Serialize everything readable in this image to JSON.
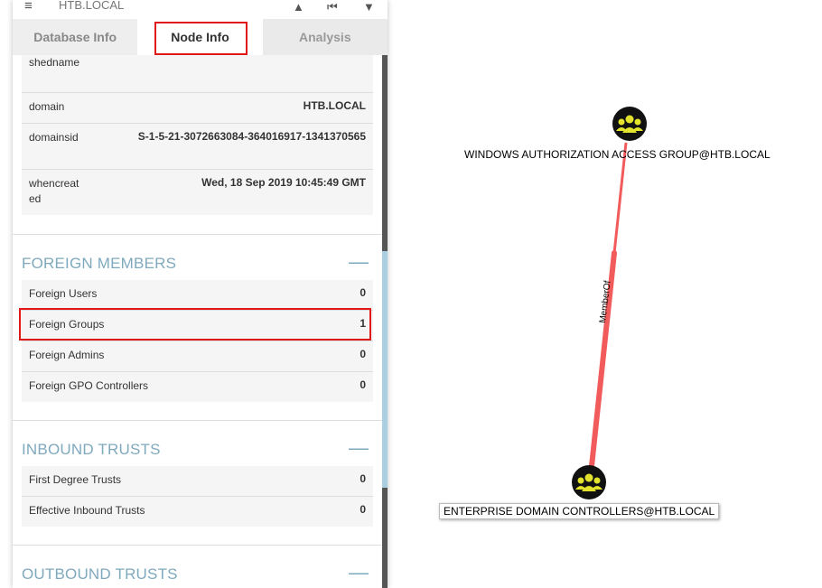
{
  "topbar": {
    "menu_icon": "≡",
    "title": "HTB.LOCAL",
    "pathfind_icon": "▲",
    "back_icon": "⏮",
    "filter_icon": "▼"
  },
  "tabs": [
    {
      "label": "Database Info"
    },
    {
      "label": "Node Info"
    },
    {
      "label": "Analysis"
    }
  ],
  "properties": [
    {
      "key": "shedname",
      "value": ""
    },
    {
      "key": "domain",
      "value": "HTB.LOCAL"
    },
    {
      "key": "domainsid",
      "value": "S-1-5-21-3072663084-364016917-1341370565"
    },
    {
      "key": "whencreated",
      "value": "Wed, 18 Sep 2019 10:45:49 GMT"
    }
  ],
  "sections": {
    "foreign_members": {
      "title": "FOREIGN MEMBERS",
      "collapse": "—",
      "rows": [
        {
          "label": "Foreign Users",
          "value": "0"
        },
        {
          "label": "Foreign Groups",
          "value": "1"
        },
        {
          "label": "Foreign Admins",
          "value": "0"
        },
        {
          "label": "Foreign GPO Controllers",
          "value": "0"
        }
      ]
    },
    "inbound_trusts": {
      "title": "INBOUND TRUSTS",
      "collapse": "—",
      "rows": [
        {
          "label": "First Degree Trusts",
          "value": "0"
        },
        {
          "label": "Effective Inbound Trusts",
          "value": "0"
        }
      ]
    },
    "outbound_trusts": {
      "title": "OUTBOUND TRUSTS",
      "collapse": "—"
    }
  },
  "graph": {
    "nodes": [
      {
        "label": "WINDOWS AUTHORIZATION ACCESS GROUP@HTB.LOCAL",
        "icon": "group-icon"
      },
      {
        "label": "ENTERPRISE DOMAIN CONTROLLERS@HTB.LOCAL",
        "icon": "group-icon"
      }
    ],
    "edge": {
      "label": "MemberOf",
      "color": "#f25b5b"
    },
    "node_color": "#111111",
    "node_icon_color": "#e3e32d"
  },
  "colors": {
    "highlight": "#e01818",
    "section_title": "#7fa9bd",
    "card_bg": "#f5f5f5"
  }
}
